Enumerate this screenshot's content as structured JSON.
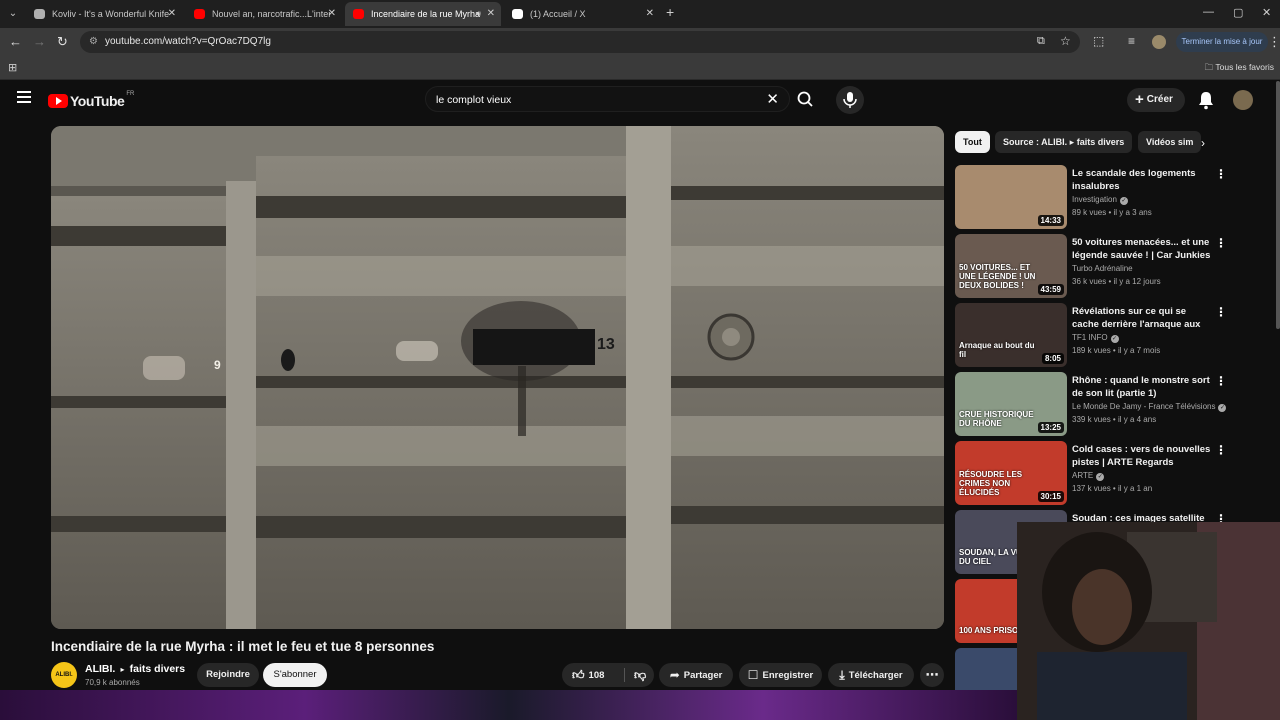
{
  "browser": {
    "tabs": [
      {
        "title": "Kovliv - It's a Wonderful Knife (",
        "favicon": "#b0b0b0"
      },
      {
        "title": "Nouvel an, narcotrafic...L'intervi",
        "favicon": "#ff0000"
      },
      {
        "title": "Incendiaire de la rue Myrha",
        "favicon": "#ff0000",
        "active": true
      },
      {
        "title": "(1) Accueil / X",
        "favicon": "#ffffff"
      }
    ],
    "url": "youtube.com/watch?v=QrOac7DQ7lg",
    "update_button": "Terminer la mise à jour",
    "bookmarks_all": "Tous les favoris"
  },
  "youtube": {
    "logo_text": "YouTube",
    "country_code": "FR",
    "search_query": "le complot vieux",
    "create_label": "Créer"
  },
  "video": {
    "title": "Incendiaire de la rue Myrha : il met le feu et tue 8 personnes",
    "channel": "ALIBI.",
    "channel_suffix": "faits divers",
    "avatar_text": "ALIBI.",
    "subscribers": "70,9 k abonnés",
    "join_label": "Rejoindre",
    "subscribe_label": "S'abonner",
    "likes": "108",
    "share_label": "Partager",
    "save_label": "Enregistrer",
    "download_label": "Télécharger",
    "mailbox_numbers": [
      "9",
      "13"
    ]
  },
  "chips": [
    "Tout",
    "Source : ALIBI. ▸ faits divers",
    "Vidéos sim"
  ],
  "recommendations": [
    {
      "title": "Le scandale des logements insalubres",
      "channel": "Investigation",
      "verified": true,
      "views": "89 k vues",
      "age": "il y a 3 ans",
      "duration": "14:33",
      "thumb_color": "#a88b6e"
    },
    {
      "title": "50 voitures menacées... et une légende sauvée ! | Car Junkies",
      "channel": "Turbo Adrénaline",
      "verified": false,
      "views": "36 k vues",
      "age": "il y a 12 jours",
      "duration": "43:59",
      "thumb_color": "#6a5a50",
      "thumb_text": "50 VOITURES... ET UNE LÉGENDE ! UN DEUX BOLIDES !"
    },
    {
      "title": "Révélations sur ce qui se cache derrière l'arnaque aux numéro...",
      "channel": "TF1 INFO",
      "verified": true,
      "views": "189 k vues",
      "age": "il y a 7 mois",
      "duration": "8:05",
      "thumb_color": "#3a2f2c",
      "thumb_text": "Arnaque au bout du fil"
    },
    {
      "title": "Rhône : quand le monstre sort de son lit (partie 1)",
      "channel": "Le Monde De Jamy - France Télévisions",
      "verified": true,
      "views": "339 k vues",
      "age": "il y a 4 ans",
      "duration": "13:25",
      "thumb_color": "#8a9a86",
      "thumb_text": "CRUE HISTORIQUE DU RHÔNE"
    },
    {
      "title": "Cold cases : vers de nouvelles pistes | ARTE Regards",
      "channel": "ARTE",
      "verified": true,
      "views": "137 k vues",
      "age": "il y a 1 an",
      "duration": "30:15",
      "thumb_color": "#c23b2b",
      "thumb_text": "RÉSOUDRE LES CRIMES NON ÉLUCIDÉS"
    },
    {
      "title": "Soudan : ces images satellite",
      "channel": "",
      "verified": false,
      "views": "",
      "age": "",
      "duration": "",
      "thumb_color": "#4a4a5a",
      "thumb_text": "SOUDAN, LA VUE DU CIEL"
    },
    {
      "title": "",
      "channel": "",
      "verified": false,
      "views": "",
      "age": "",
      "duration": "",
      "thumb_color": "#c23b2b",
      "thumb_text": "100 ANS PRISON"
    },
    {
      "title": "",
      "channel": "",
      "verified": false,
      "views": "",
      "age": "",
      "duration": "",
      "thumb_color": "#3a4a6a"
    }
  ]
}
